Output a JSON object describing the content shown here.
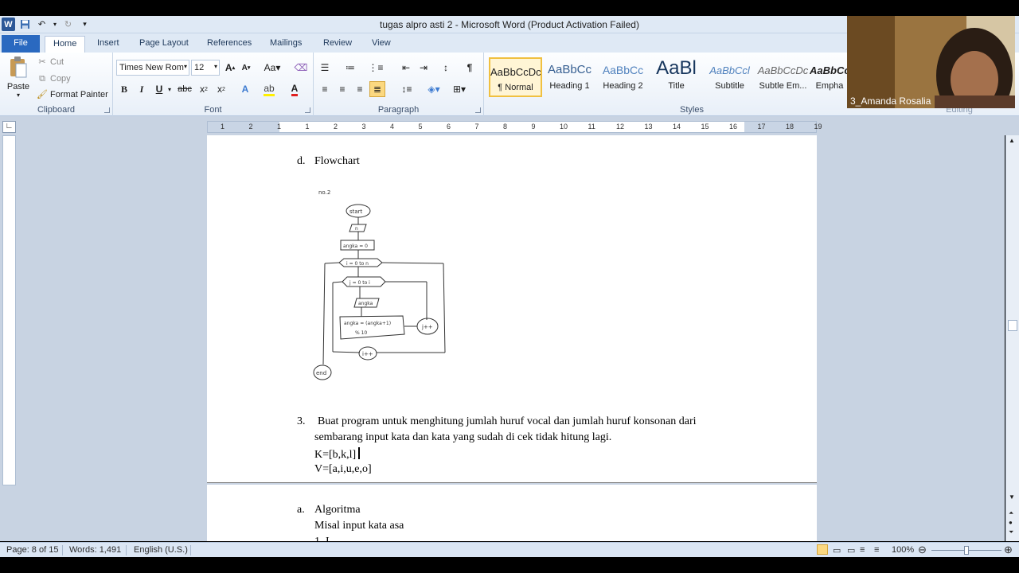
{
  "window": {
    "title": "tugas alpro asti 2  -  Microsoft Word (Product Activation Failed)"
  },
  "tabs": [
    "File",
    "Home",
    "Insert",
    "Page Layout",
    "References",
    "Mailings",
    "Review",
    "View"
  ],
  "ribbon": {
    "clipboard": {
      "paste": "Paste",
      "cut": "Cut",
      "copy": "Copy",
      "format_painter": "Format Painter",
      "label": "Clipboard"
    },
    "font": {
      "font_name": "Times New Rom",
      "font_size": "12",
      "label": "Font"
    },
    "paragraph": {
      "label": "Paragraph"
    },
    "styles": {
      "items": [
        {
          "sample": "AaBbCcDc",
          "name": "¶ Normal"
        },
        {
          "sample": "AaBbCc",
          "name": "Heading 1"
        },
        {
          "sample": "AaBbCc",
          "name": "Heading 2"
        },
        {
          "sample": "AaBl",
          "name": "Title"
        },
        {
          "sample": "AaBbCcl",
          "name": "Subtitle"
        },
        {
          "sample": "AaBbCcDc",
          "name": "Subtle Em..."
        },
        {
          "sample": "AaBbCcDc",
          "name": "Empha"
        }
      ],
      "label": "Styles"
    },
    "editing": {
      "label": "Editing"
    }
  },
  "ruler": {
    "numbers": [
      "1",
      "2",
      "1",
      "1",
      "2",
      "3",
      "4",
      "5",
      "6",
      "7",
      "8",
      "9",
      "10",
      "11",
      "12",
      "13",
      "14",
      "15",
      "16",
      "17",
      "18",
      "19"
    ]
  },
  "document": {
    "heading_d_marker": "d.",
    "heading_d": "Flowchart",
    "flowchart": {
      "label_no": "no.2",
      "start": "start",
      "n": "n",
      "init": "angka = 0",
      "loop_i": "i = 0 to n",
      "loop_j": "j = 0 to i",
      "input": "angka",
      "process_line1": "angka = (angka+1)",
      "process_line2": "% 10",
      "j_inc": "j++",
      "i_inc": "i++",
      "end": "end"
    },
    "item3_number": "3.",
    "item3_line1": "Buat program untuk menghitung jumlah  huruf vocal dan jumlah huruf konsonan dari",
    "item3_line2": "sembarang input kata dan kata yang sudah di cek tidak hitung lagi.",
    "k_line": "K=[b,k,l]",
    "v_line": "V=[a,i,u,e,o]",
    "a_marker": "a.",
    "a_heading": "Algoritma",
    "a_line1": "Misal input kata asa",
    "a_line2": "1. I"
  },
  "status": {
    "page": "Page: 8 of 15",
    "words": "Words: 1,491",
    "language": "English (U.S.)",
    "zoom": "100%"
  },
  "webcam": {
    "name": "3_Amanda Rosalia"
  }
}
